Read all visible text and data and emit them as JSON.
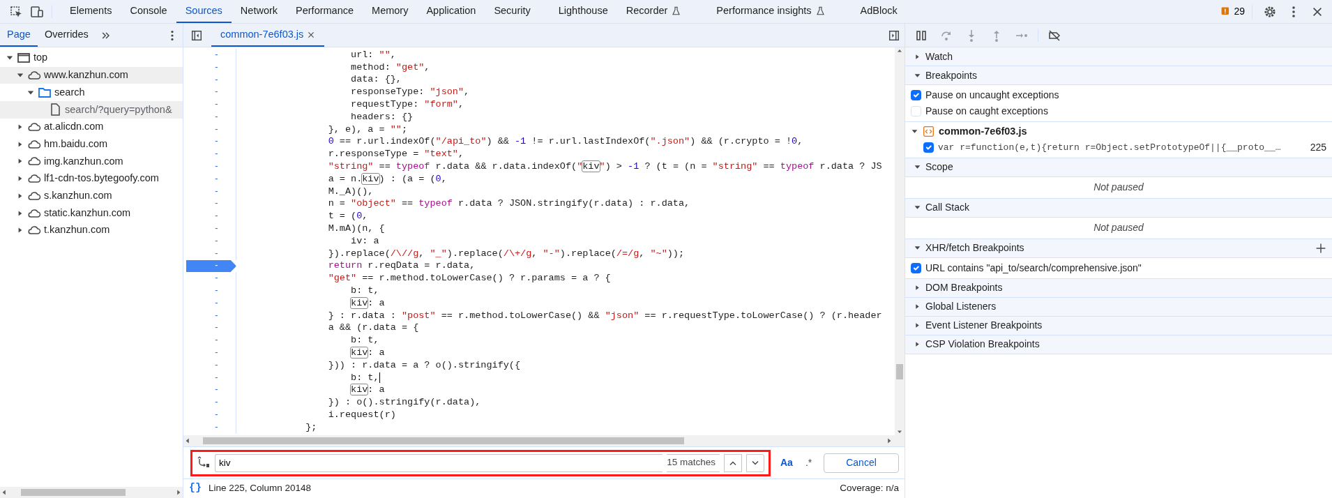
{
  "toolbar": {
    "tabs": [
      {
        "label": "Elements",
        "selected": false,
        "experimental": false
      },
      {
        "label": "Console",
        "selected": false,
        "experimental": false
      },
      {
        "label": "Sources",
        "selected": true,
        "experimental": false
      },
      {
        "label": "Network",
        "selected": false,
        "experimental": false
      },
      {
        "label": "Performance",
        "selected": false,
        "experimental": false
      },
      {
        "label": "Memory",
        "selected": false,
        "experimental": false
      },
      {
        "label": "Application",
        "selected": false,
        "experimental": false
      },
      {
        "label": "Security",
        "selected": false,
        "experimental": false
      },
      {
        "label": "Lighthouse",
        "selected": false,
        "experimental": false
      },
      {
        "label": "Recorder",
        "selected": false,
        "experimental": true
      },
      {
        "label": "Performance insights",
        "selected": false,
        "experimental": true
      },
      {
        "label": "AdBlock",
        "selected": false,
        "experimental": false
      }
    ],
    "issues_count": "29"
  },
  "navigator": {
    "tabs": [
      {
        "label": "Page",
        "selected": true
      },
      {
        "label": "Overrides",
        "selected": false
      }
    ],
    "tree": [
      {
        "label": "top",
        "kind": "frame",
        "expanded": true,
        "selected": false,
        "children": [
          {
            "label": "www.kanzhun.com",
            "kind": "domain",
            "expanded": true,
            "selected": true,
            "children": [
              {
                "label": "search",
                "kind": "folder",
                "expanded": true,
                "selected": false,
                "children": [
                  {
                    "label": "search/?query=python&",
                    "kind": "file",
                    "selected": true
                  }
                ]
              }
            ]
          },
          {
            "label": "at.alicdn.com",
            "kind": "domain",
            "expanded": false,
            "selected": false
          },
          {
            "label": "hm.baidu.com",
            "kind": "domain",
            "expanded": false,
            "selected": false
          },
          {
            "label": "img.kanzhun.com",
            "kind": "domain",
            "expanded": false,
            "selected": false
          },
          {
            "label": "lf1-cdn-tos.bytegoofy.com",
            "kind": "domain",
            "expanded": false,
            "selected": false
          },
          {
            "label": "s.kanzhun.com",
            "kind": "domain",
            "expanded": false,
            "selected": false
          },
          {
            "label": "static.kanzhun.com",
            "kind": "domain",
            "expanded": false,
            "selected": false
          },
          {
            "label": "t.kanzhun.com",
            "kind": "domain",
            "expanded": false,
            "selected": false
          }
        ]
      }
    ]
  },
  "editor": {
    "file_tab": {
      "label": "common-7e6f03.js",
      "selected": true
    },
    "lines": [
      {
        "gutter": "-",
        "breakpoint": false,
        "cursor": false,
        "tokens": [
          {
            "kind": "plain",
            "text": "                    url: "
          },
          {
            "kind": "string",
            "text": "\"\""
          },
          {
            "kind": "plain",
            "text": ","
          }
        ]
      },
      {
        "gutter": "-",
        "breakpoint": false,
        "cursor": false,
        "tokens": [
          {
            "kind": "plain",
            "text": "                    method: "
          },
          {
            "kind": "string",
            "text": "\"get\""
          },
          {
            "kind": "plain",
            "text": ","
          }
        ]
      },
      {
        "gutter": "-",
        "breakpoint": false,
        "cursor": false,
        "tokens": [
          {
            "kind": "plain",
            "text": "                    data: {},"
          }
        ]
      },
      {
        "gutter": "-",
        "breakpoint": false,
        "cursor": false,
        "tokens": [
          {
            "kind": "plain",
            "text": "                    responseType: "
          },
          {
            "kind": "string",
            "text": "\"json\""
          },
          {
            "kind": "plain",
            "text": ","
          }
        ]
      },
      {
        "gutter": "-",
        "breakpoint": false,
        "cursor": false,
        "tokens": [
          {
            "kind": "plain",
            "text": "                    requestType: "
          },
          {
            "kind": "string",
            "text": "\"form\""
          },
          {
            "kind": "plain",
            "text": ","
          }
        ]
      },
      {
        "gutter": "-",
        "breakpoint": false,
        "cursor": false,
        "tokens": [
          {
            "kind": "plain",
            "text": "                    headers: {}"
          }
        ]
      },
      {
        "gutter": "-",
        "breakpoint": false,
        "cursor": false,
        "tokens": [
          {
            "kind": "plain",
            "text": "                }, e), a = "
          },
          {
            "kind": "string",
            "text": "\"\""
          },
          {
            "kind": "plain",
            "text": ";"
          }
        ]
      },
      {
        "gutter": "-",
        "breakpoint": false,
        "cursor": false,
        "tokens": [
          {
            "kind": "number",
            "text": "                0"
          },
          {
            "kind": "plain",
            "text": " == r.url.indexOf("
          },
          {
            "kind": "string",
            "text": "\"/api_to\""
          },
          {
            "kind": "plain",
            "text": ") && "
          },
          {
            "kind": "number",
            "text": "-1"
          },
          {
            "kind": "plain",
            "text": " != r.url.lastIndexOf("
          },
          {
            "kind": "string",
            "text": "\".json\""
          },
          {
            "kind": "plain",
            "text": ") && (r.crypto = !"
          },
          {
            "kind": "number",
            "text": "0"
          },
          {
            "kind": "plain",
            "text": ","
          }
        ]
      },
      {
        "gutter": "-",
        "breakpoint": false,
        "cursor": false,
        "tokens": [
          {
            "kind": "plain",
            "text": "                r.responseType = "
          },
          {
            "kind": "string",
            "text": "\"text\""
          },
          {
            "kind": "plain",
            "text": ","
          }
        ]
      },
      {
        "gutter": "-",
        "breakpoint": false,
        "cursor": false,
        "tokens": [
          {
            "kind": "string",
            "text": "                \"string\""
          },
          {
            "kind": "plain",
            "text": " == "
          },
          {
            "kind": "keyword",
            "text": "typeof"
          },
          {
            "kind": "plain",
            "text": " r.data && r.data.indexOf("
          },
          {
            "kind": "string",
            "text": "\""
          },
          {
            "kind": "match",
            "text": "kiv"
          },
          {
            "kind": "string",
            "text": "\""
          },
          {
            "kind": "plain",
            "text": ") > "
          },
          {
            "kind": "number",
            "text": "-1"
          },
          {
            "kind": "plain",
            "text": " ? (t = (n = "
          },
          {
            "kind": "string",
            "text": "\"string\""
          },
          {
            "kind": "plain",
            "text": " == "
          },
          {
            "kind": "keyword",
            "text": "typeof"
          },
          {
            "kind": "plain",
            "text": " r.data ? JS"
          }
        ]
      },
      {
        "gutter": "-",
        "breakpoint": false,
        "cursor": false,
        "tokens": [
          {
            "kind": "plain",
            "text": "                a = n."
          },
          {
            "kind": "match",
            "text": "kiv"
          },
          {
            "kind": "plain",
            "text": ") : (a = ("
          },
          {
            "kind": "number",
            "text": "0"
          },
          {
            "kind": "plain",
            "text": ","
          }
        ]
      },
      {
        "gutter": "-",
        "breakpoint": false,
        "cursor": false,
        "tokens": [
          {
            "kind": "plain",
            "text": "                M._A)(),"
          }
        ]
      },
      {
        "gutter": "-",
        "breakpoint": false,
        "cursor": false,
        "tokens": [
          {
            "kind": "plain",
            "text": "                n = "
          },
          {
            "kind": "string",
            "text": "\"object\""
          },
          {
            "kind": "plain",
            "text": " == "
          },
          {
            "kind": "keyword",
            "text": "typeof"
          },
          {
            "kind": "plain",
            "text": " r.data ? JSON.stringify(r.data) : r.data,"
          }
        ]
      },
      {
        "gutter": "-",
        "breakpoint": false,
        "cursor": false,
        "tokens": [
          {
            "kind": "plain",
            "text": "                t = ("
          },
          {
            "kind": "number",
            "text": "0"
          },
          {
            "kind": "plain",
            "text": ","
          }
        ]
      },
      {
        "gutter": "-",
        "breakpoint": false,
        "cursor": false,
        "tokens": [
          {
            "kind": "plain",
            "text": "                M.mA)(n, {"
          }
        ]
      },
      {
        "gutter": "-",
        "breakpoint": false,
        "cursor": false,
        "tokens": [
          {
            "kind": "plain",
            "text": "                    iv: a"
          }
        ]
      },
      {
        "gutter": "-",
        "breakpoint": false,
        "cursor": false,
        "tokens": [
          {
            "kind": "plain",
            "text": "                }).replace("
          },
          {
            "kind": "string",
            "text": "/\\//g"
          },
          {
            "kind": "plain",
            "text": ", "
          },
          {
            "kind": "string",
            "text": "\"_\""
          },
          {
            "kind": "plain",
            "text": ").replace("
          },
          {
            "kind": "string",
            "text": "/\\+/g"
          },
          {
            "kind": "plain",
            "text": ", "
          },
          {
            "kind": "string",
            "text": "\"-\""
          },
          {
            "kind": "plain",
            "text": ").replace("
          },
          {
            "kind": "string",
            "text": "/=/g"
          },
          {
            "kind": "plain",
            "text": ", "
          },
          {
            "kind": "string",
            "text": "\"~\""
          },
          {
            "kind": "plain",
            "text": "));"
          }
        ]
      },
      {
        "gutter": "-",
        "breakpoint": true,
        "cursor": false,
        "tokens": [
          {
            "kind": "keyword",
            "text": "                return"
          },
          {
            "kind": "plain",
            "text": " r.reqData = r.data,"
          }
        ]
      },
      {
        "gutter": "-",
        "breakpoint": false,
        "cursor": false,
        "tokens": [
          {
            "kind": "string",
            "text": "                \"get\""
          },
          {
            "kind": "plain",
            "text": " == r.method.toLowerCase() ? r.params = a ? {"
          }
        ]
      },
      {
        "gutter": "-",
        "breakpoint": false,
        "cursor": false,
        "tokens": [
          {
            "kind": "plain",
            "text": "                    b: t,"
          }
        ]
      },
      {
        "gutter": "-",
        "breakpoint": false,
        "cursor": false,
        "tokens": [
          {
            "kind": "match",
            "text": "                    kiv"
          },
          {
            "kind": "plain",
            "text": ": a"
          }
        ]
      },
      {
        "gutter": "-",
        "breakpoint": false,
        "cursor": false,
        "tokens": [
          {
            "kind": "plain",
            "text": "                } : r.data : "
          },
          {
            "kind": "string",
            "text": "\"post\""
          },
          {
            "kind": "plain",
            "text": " == r.method.toLowerCase() && "
          },
          {
            "kind": "string",
            "text": "\"json\""
          },
          {
            "kind": "plain",
            "text": " == r.requestType.toLowerCase() ? (r.header"
          }
        ]
      },
      {
        "gutter": "-",
        "breakpoint": false,
        "cursor": false,
        "tokens": [
          {
            "kind": "plain",
            "text": "                a && (r.data = {"
          }
        ]
      },
      {
        "gutter": "-",
        "breakpoint": false,
        "cursor": false,
        "tokens": [
          {
            "kind": "plain",
            "text": "                    b: t,"
          }
        ]
      },
      {
        "gutter": "-",
        "breakpoint": false,
        "cursor": false,
        "tokens": [
          {
            "kind": "match",
            "text": "                    kiv"
          },
          {
            "kind": "plain",
            "text": ": a"
          }
        ]
      },
      {
        "gutter": "-",
        "breakpoint": false,
        "cursor": false,
        "tokens": [
          {
            "kind": "plain",
            "text": "                })) : r.data = a ? o().stringify({"
          }
        ]
      },
      {
        "gutter": "-",
        "breakpoint": false,
        "cursor": true,
        "tokens": [
          {
            "kind": "plain",
            "text": "                    b: t,"
          }
        ]
      },
      {
        "gutter": "-",
        "breakpoint": false,
        "cursor": false,
        "tokens": [
          {
            "kind": "match",
            "text": "                    kiv"
          },
          {
            "kind": "plain",
            "text": ": a"
          }
        ]
      },
      {
        "gutter": "-",
        "breakpoint": false,
        "cursor": false,
        "tokens": [
          {
            "kind": "plain",
            "text": "                }) : o().stringify(r.data),"
          }
        ]
      },
      {
        "gutter": "-",
        "breakpoint": false,
        "cursor": false,
        "tokens": [
          {
            "kind": "plain",
            "text": "                i.request(r)"
          }
        ]
      },
      {
        "gutter": "-",
        "breakpoint": false,
        "cursor": false,
        "tokens": [
          {
            "kind": "plain",
            "text": "            };"
          }
        ]
      }
    ]
  },
  "search": {
    "highlighted": true,
    "value": "kiv",
    "matches": "15 matches",
    "match_case": "Aa",
    "match_case_on": true,
    "regex": ".*",
    "regex_on": false,
    "cancel": "Cancel"
  },
  "status": {
    "format_icon": "{}",
    "position": "Line 225, Column 20148",
    "coverage": "Coverage: n/a"
  },
  "debugger": {
    "controls": [
      {
        "kind": "pause",
        "disabled": false
      },
      {
        "kind": "step-over",
        "disabled": true
      },
      {
        "kind": "step-into",
        "disabled": true
      },
      {
        "kind": "step-out",
        "disabled": true
      },
      {
        "kind": "step",
        "disabled": true
      },
      {
        "kind": "deactivate",
        "disabled": false
      }
    ],
    "sections": [
      {
        "title": "Watch",
        "expanded": false
      },
      {
        "title": "Breakpoints",
        "expanded": true,
        "items": [
          {
            "kind": "checkbox",
            "label": "Pause on uncaught exceptions",
            "checked": true
          },
          {
            "kind": "checkbox",
            "label": "Pause on caught exceptions",
            "checked": false
          },
          {
            "kind": "file",
            "label": "common-7e6f03.js",
            "expanded": true
          },
          {
            "kind": "breakpoint",
            "code": "var r=function(e,t){return r=Object.setPrototypeOf||{__proto__…",
            "line": "225",
            "checked": true
          }
        ]
      },
      {
        "title": "Scope",
        "expanded": true,
        "items": [
          {
            "kind": "message",
            "label": "Not paused"
          }
        ]
      },
      {
        "title": "Call Stack",
        "expanded": true,
        "items": [
          {
            "kind": "message",
            "label": "Not paused"
          }
        ]
      },
      {
        "title": "XHR/fetch Breakpoints",
        "expanded": true,
        "add": true,
        "items": [
          {
            "kind": "checkbox",
            "label": "URL contains \"api_to/search/comprehensive.json\"",
            "checked": true
          }
        ]
      },
      {
        "title": "DOM Breakpoints",
        "expanded": false
      },
      {
        "title": "Global Listeners",
        "expanded": false
      },
      {
        "title": "Event Listener Breakpoints",
        "expanded": false
      },
      {
        "title": "CSP Violation Breakpoints",
        "expanded": false
      }
    ]
  }
}
